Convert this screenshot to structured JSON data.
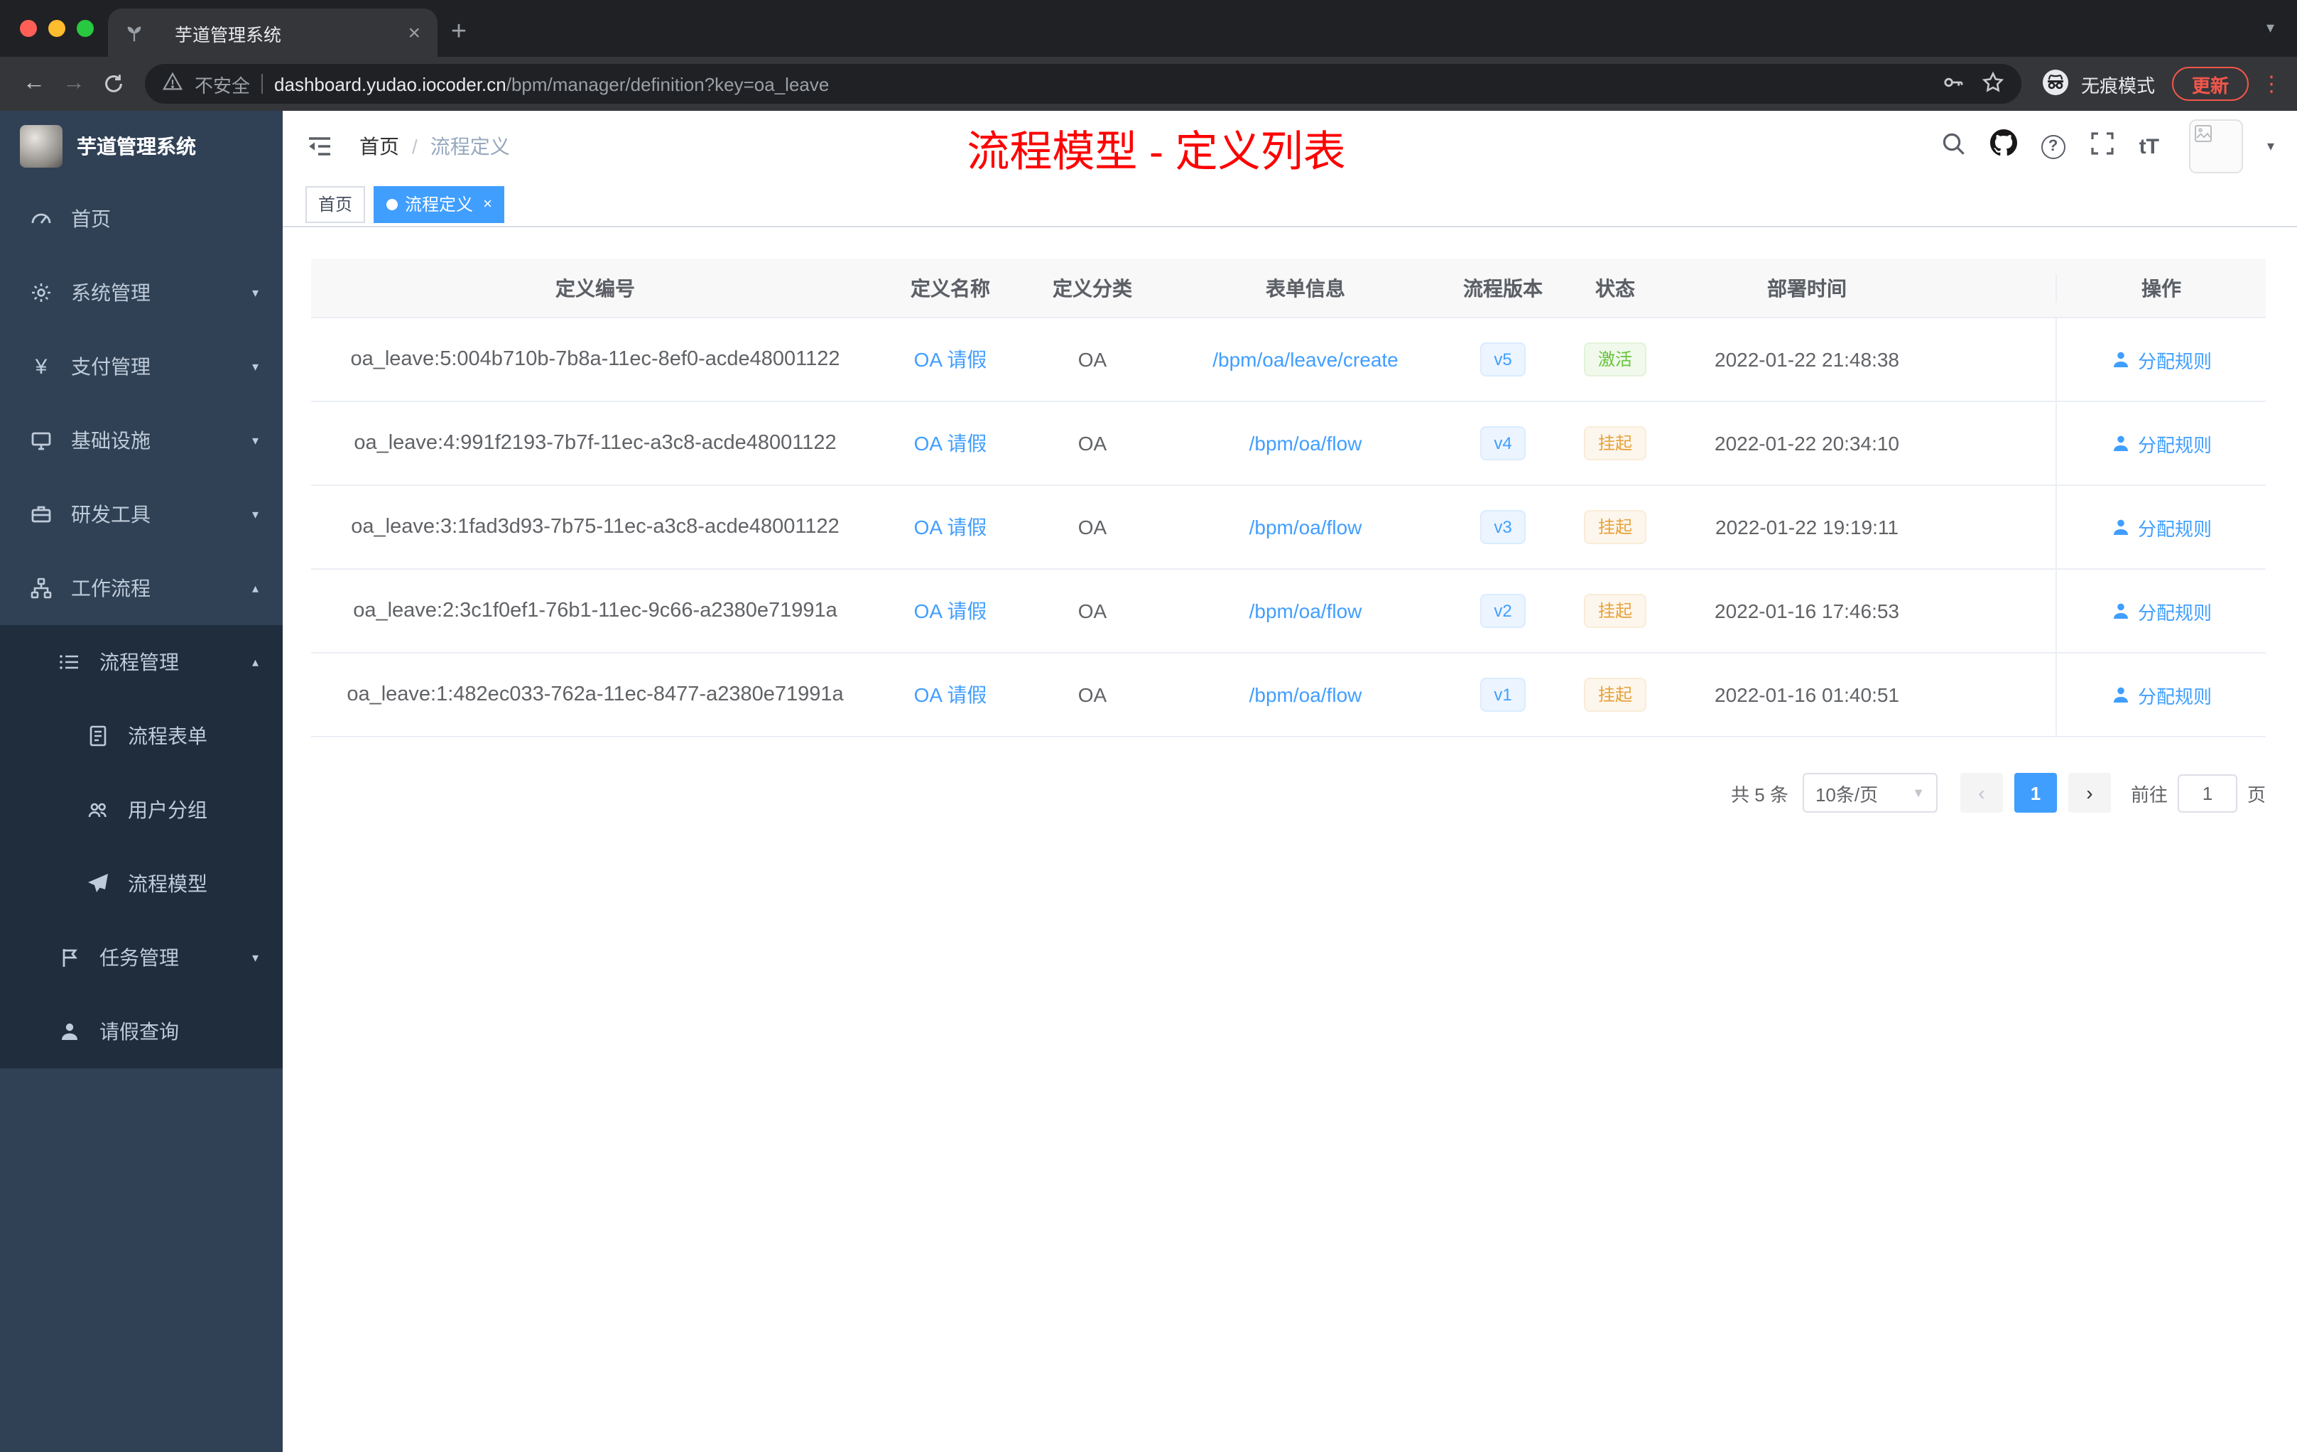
{
  "browser": {
    "tab_title": "芋道管理系统",
    "security_label": "不安全",
    "url_host": "dashboard.yudao.iocoder.cn",
    "url_path": "/bpm/manager/definition?key=oa_leave",
    "incognito_label": "无痕模式",
    "update_label": "更新"
  },
  "sidebar": {
    "brand": "芋道管理系统",
    "items": [
      {
        "label": "首页"
      },
      {
        "label": "系统管理"
      },
      {
        "label": "支付管理"
      },
      {
        "label": "基础设施"
      },
      {
        "label": "研发工具"
      },
      {
        "label": "工作流程"
      },
      {
        "label": "流程管理"
      },
      {
        "label": "流程表单"
      },
      {
        "label": "用户分组"
      },
      {
        "label": "流程模型"
      },
      {
        "label": "任务管理"
      },
      {
        "label": "请假查询"
      }
    ]
  },
  "header": {
    "breadcrumb_home": "首页",
    "breadcrumb_current": "流程定义",
    "annotation": "流程模型 - 定义列表"
  },
  "tags": {
    "home": "首页",
    "active": "流程定义"
  },
  "table": {
    "columns": [
      "定义编号",
      "定义名称",
      "定义分类",
      "表单信息",
      "流程版本",
      "状态",
      "部署时间",
      "操作"
    ],
    "op_label": "分配规则",
    "rows": [
      {
        "id": "oa_leave:5:004b710b-7b8a-11ec-8ef0-acde48001122",
        "name": "OA 请假",
        "category": "OA",
        "form": "/bpm/oa/leave/create",
        "version": "v5",
        "status": "激活",
        "time": "2022-01-22 21:48:38"
      },
      {
        "id": "oa_leave:4:991f2193-7b7f-11ec-a3c8-acde48001122",
        "name": "OA 请假",
        "category": "OA",
        "form": "/bpm/oa/flow",
        "version": "v4",
        "status": "挂起",
        "time": "2022-01-22 20:34:10"
      },
      {
        "id": "oa_leave:3:1fad3d93-7b75-11ec-a3c8-acde48001122",
        "name": "OA 请假",
        "category": "OA",
        "form": "/bpm/oa/flow",
        "version": "v3",
        "status": "挂起",
        "time": "2022-01-22 19:19:11"
      },
      {
        "id": "oa_leave:2:3c1f0ef1-76b1-11ec-9c66-a2380e71991a",
        "name": "OA 请假",
        "category": "OA",
        "form": "/bpm/oa/flow",
        "version": "v2",
        "status": "挂起",
        "time": "2022-01-16 17:46:53"
      },
      {
        "id": "oa_leave:1:482ec033-762a-11ec-8477-a2380e71991a",
        "name": "OA 请假",
        "category": "OA",
        "form": "/bpm/oa/flow",
        "version": "v1",
        "status": "挂起",
        "time": "2022-01-16 01:40:51"
      }
    ]
  },
  "pagination": {
    "total": "共 5 条",
    "page_size": "10条/页",
    "current": "1",
    "goto_label": "前往",
    "goto_value": "1",
    "page_unit": "页"
  },
  "colors": {
    "accent": "#409eff",
    "success": "#67c23a",
    "warning": "#e6a23c",
    "annotation": "#fe0000",
    "sidebar": "#304156",
    "sidebar_dark": "#1f2d3d"
  }
}
